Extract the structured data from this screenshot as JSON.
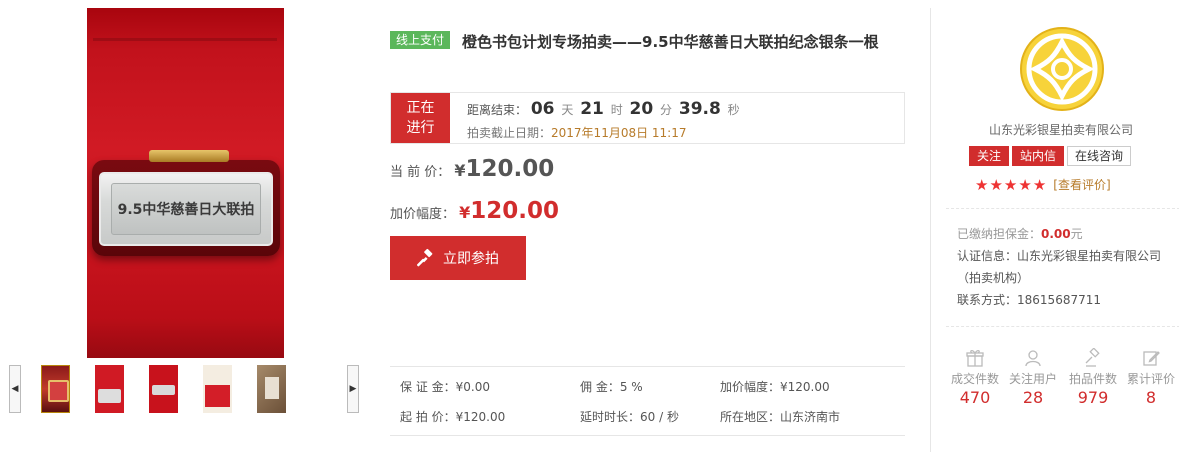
{
  "gallery": {
    "main_image_caption": "9.5中华慈善日大联拍",
    "prev_arrow": "◀",
    "next_arrow": "▶"
  },
  "lot": {
    "payment_badge": "线上支付",
    "title": "橙色书包计划专场拍卖——9.5中华慈善日大联拍纪念银条一根",
    "status_line1": "正在",
    "status_line2": "进行",
    "countdown_label": "距离结束：",
    "countdown": {
      "days": "06",
      "days_unit": "天",
      "hours": "21",
      "hours_unit": "时",
      "minutes": "20",
      "minutes_unit": "分",
      "seconds": "39.8",
      "seconds_unit": "秒"
    },
    "deadline_label": "拍卖截止日期：",
    "deadline_value": "2017年11月08日 11:17",
    "current_price_label": "当  前  价：",
    "current_price_symbol": "¥",
    "current_price_value": "120.00",
    "increment_label": "加价幅度：",
    "increment_symbol": "¥",
    "increment_value": "120.00",
    "bid_button": "立即参拍"
  },
  "terms": {
    "deposit": "保  证  金：¥0.00",
    "commission": "佣        金：5 %",
    "increment": "加价幅度：¥120.00",
    "start_price": "起  拍  价：¥120.00",
    "delay": "延时时长：60 / 秒",
    "location": "所在地区：山东济南市"
  },
  "seller": {
    "name": "山东光彩银星拍卖有限公司",
    "follow_button": "关注",
    "message_button": "站内信",
    "consult_button": "在线咨询",
    "stars": [
      "★",
      "★",
      "★",
      "★",
      "★"
    ],
    "reviews_link": "[查看评价]",
    "deposit_paid_label": "已缴纳担保金：",
    "deposit_paid_value": "0.00",
    "deposit_paid_unit": "元",
    "cert_label": "认证信息：",
    "cert_value": "山东光彩银星拍卖有限公司（拍卖机构）",
    "contact_label": "联系方式：",
    "contact_value": "18615687711",
    "stats": [
      {
        "icon": "gift-icon",
        "label": "成交件数",
        "value": "470"
      },
      {
        "icon": "user-icon",
        "label": "关注用户",
        "value": "28"
      },
      {
        "icon": "hammer-icon",
        "label": "拍品件数",
        "value": "979"
      },
      {
        "icon": "edit-icon",
        "label": "累计评价",
        "value": "8"
      }
    ]
  },
  "colors": {
    "accent_red": "#d12d2d",
    "badge_green": "#5bb75b",
    "date_brown": "#b77b2a"
  }
}
